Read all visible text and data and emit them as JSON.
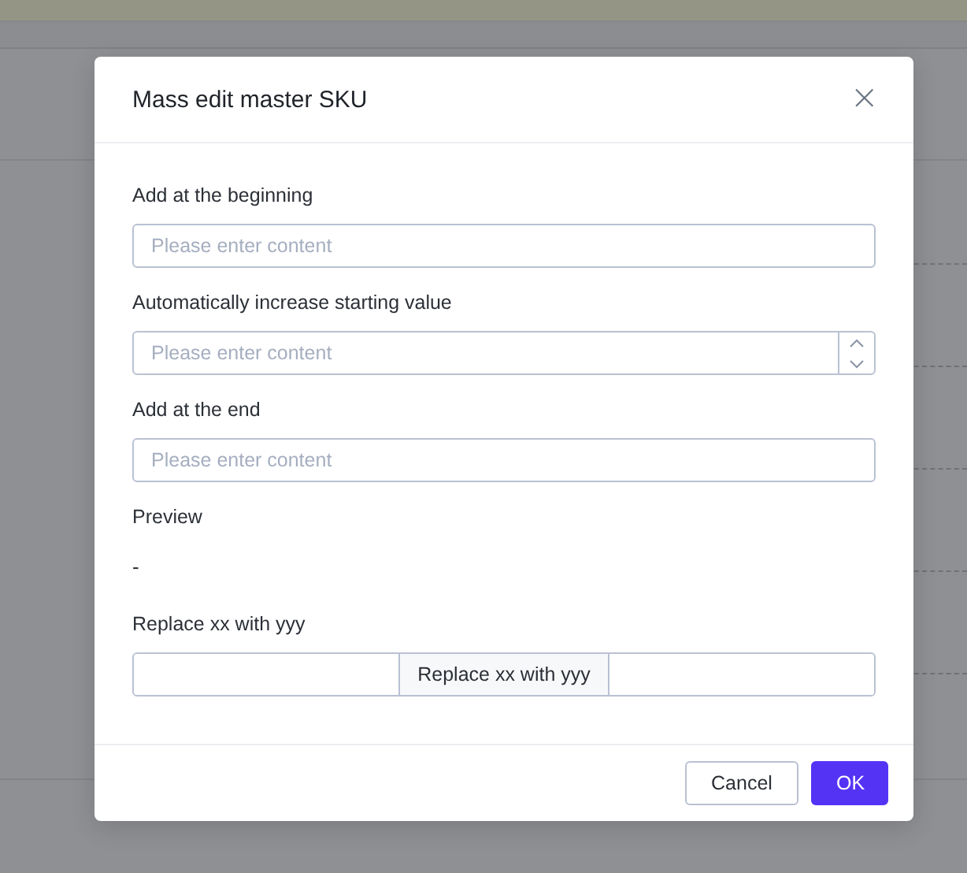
{
  "dialog": {
    "title": "Mass edit master SKU",
    "close": "×",
    "fields": [
      {
        "kind": "text",
        "label": "Add at the beginning",
        "placeholder": "Please enter content"
      },
      {
        "kind": "number",
        "label": "Automatically increase starting value",
        "placeholder": "Please enter content"
      },
      {
        "kind": "text",
        "label": "Add at the end",
        "placeholder": "Please enter content"
      },
      {
        "kind": "preview",
        "label": "Preview",
        "value": "-"
      },
      {
        "kind": "replace",
        "label": "Replace xx with yyy",
        "middle": "Replace xx with yyy"
      }
    ],
    "buttons": [
      {
        "kind": "secondary",
        "label": "Cancel"
      },
      {
        "kind": "primary",
        "label": "OK"
      }
    ]
  }
}
